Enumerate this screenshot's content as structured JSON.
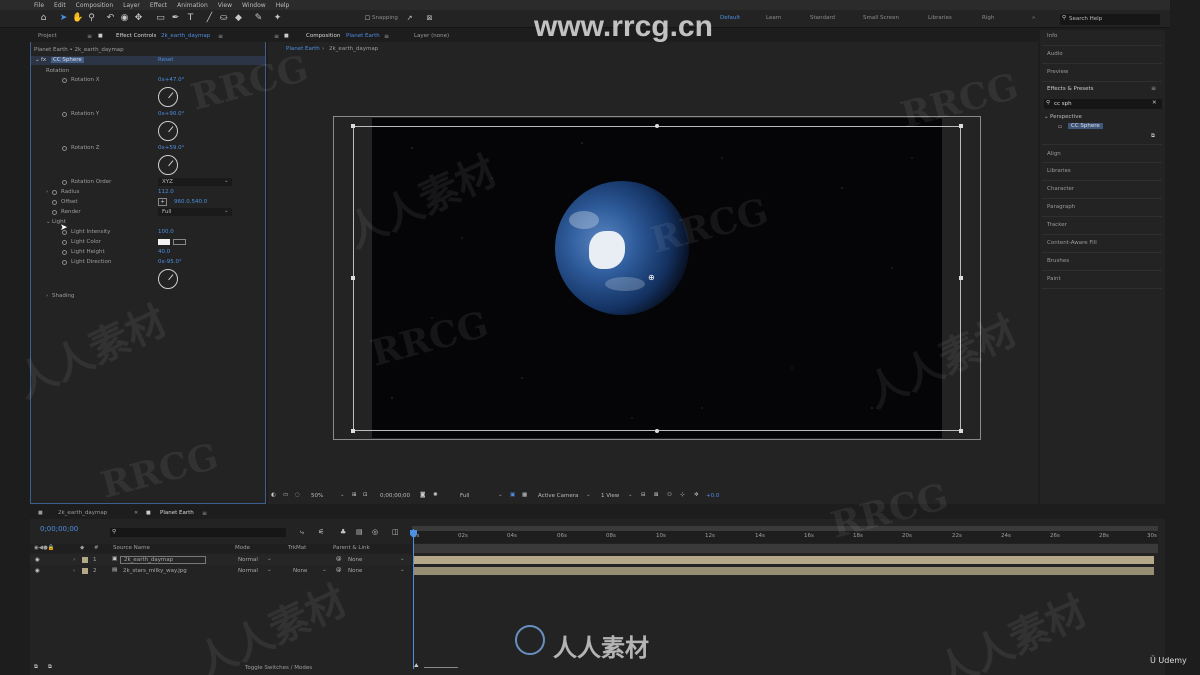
{
  "menu": [
    "File",
    "Edit",
    "Composition",
    "Layer",
    "Effect",
    "Animation",
    "View",
    "Window",
    "Help"
  ],
  "toolbar": {
    "snapping": "Snapping",
    "workspaces": [
      "Default",
      "Learn",
      "Standard",
      "Small Screen",
      "Libraries",
      "Righ"
    ],
    "active_workspace": "Default",
    "search_help": "Search Help"
  },
  "left_panel": {
    "tabs": [
      "Project",
      "Effect Controls",
      "2k_earth_daymap"
    ],
    "breadcrumb": "Planet Earth • 2k_earth_daymap",
    "effect_name": "CC Sphere",
    "reset": "Reset",
    "rotation": "Rotation",
    "rotation_x": {
      "label": "Rotation X",
      "value": "0x+47.0°"
    },
    "rotation_y": {
      "label": "Rotation Y",
      "value": "0x+90.0°"
    },
    "rotation_z": {
      "label": "Rotation Z",
      "value": "0x+59.0°"
    },
    "rotation_order": {
      "label": "Rotation Order",
      "value": "XYZ"
    },
    "radius": {
      "label": "Radius",
      "value": "112.0"
    },
    "offset": {
      "label": "Offset",
      "value": "960.0,540.0"
    },
    "render": {
      "label": "Render",
      "value": "Full"
    },
    "light": "Light",
    "light_intensity": {
      "label": "Light Intensity",
      "value": "100.0"
    },
    "light_color": {
      "label": "Light Color"
    },
    "light_height": {
      "label": "Light Height",
      "value": "40.0"
    },
    "light_direction": {
      "label": "Light Direction",
      "value": "0x-95.0°"
    },
    "shading": "Shading"
  },
  "composition": {
    "tab_label": "Composition",
    "tab_name": "Planet Earth",
    "layer_tab": "Layer (none)",
    "sub_tabs": [
      "Planet Earth",
      "2k_earth_daymap"
    ]
  },
  "viewer_bar": {
    "zoom": "50%",
    "timecode": "0;00;00;00",
    "resolution": "Full",
    "camera": "Active Camera",
    "views": "1 View",
    "exposure": "+0.0"
  },
  "right_panel": {
    "items_top": [
      "Info",
      "Audio",
      "Preview",
      "Effects & Presets"
    ],
    "search": "cc sph",
    "category": "Perspective",
    "result": "CC Sphere",
    "items_bottom": [
      "Align",
      "Libraries",
      "Character",
      "Paragraph",
      "Tracker",
      "Content-Aware Fill",
      "Brushes",
      "Paint"
    ]
  },
  "timeline": {
    "tabs": [
      "2k_earth_daymap",
      "Planet Earth"
    ],
    "active_tab": "Planet Earth",
    "timecode": "0;00;00;00",
    "columns": [
      "Source Name",
      "Mode",
      "TrkMat",
      "Parent & Link"
    ],
    "layers": [
      {
        "num": "1",
        "name": "2k_earth_daymap",
        "mode": "Normal",
        "trkmat": "",
        "parent": "None"
      },
      {
        "num": "2",
        "name": "2k_stars_milky_way.jpg",
        "mode": "Normal",
        "trkmat": "None",
        "parent": "None"
      }
    ],
    "ruler": [
      "0s",
      "02s",
      "04s",
      "06s",
      "08s",
      "10s",
      "12s",
      "14s",
      "16s",
      "18s",
      "20s",
      "22s",
      "24s",
      "26s",
      "28s",
      "30s"
    ],
    "toggle": "Toggle Switches / Modes"
  },
  "watermarks": {
    "site": "www.rrcg.cn",
    "brand": "RRCG",
    "chinese": "人人素材",
    "udemy": "Udemy"
  },
  "colors": {
    "accent": "#4d8fe0",
    "panel": "#232323",
    "layer_bar": "#b3a887"
  }
}
